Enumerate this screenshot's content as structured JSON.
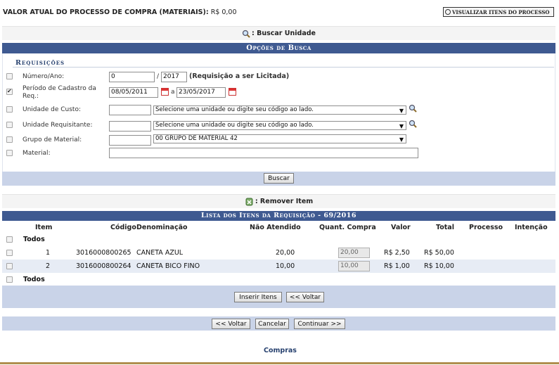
{
  "header": {
    "title_label": "VALOR ATUAL DO PROCESSO DE COMPRA (MATERIAIS):",
    "title_value": "R$ 0,00",
    "view_items_button": "VISUALIZAR ITENS DO PROCESSO"
  },
  "search_unit_link": ": Buscar Unidade",
  "search_options": {
    "header": "Opções de Busca",
    "caption": "Requisições",
    "number_year": {
      "label": "Número/Ano:",
      "number": "0",
      "year": "2017",
      "note": "(Requisição a ser Licitada)",
      "checked": false
    },
    "period": {
      "label": "Período de Cadastro da Req.:",
      "from": "08/05/2011",
      "sep": "a",
      "to": "23/05/2017",
      "checked": true
    },
    "cost_unit": {
      "label": "Unidade de Custo:",
      "code": "",
      "select": "Selecione uma unidade ou digite seu código ao lado.",
      "checked": false
    },
    "requesting_unit": {
      "label": "Unidade Requisitante:",
      "code": "",
      "select": "Selecione uma unidade ou digite seu código ao lado.",
      "checked": false
    },
    "material_group": {
      "label": "Grupo de Material:",
      "code": "",
      "select": "00 GRUPO DE MATERIAL 42",
      "checked": false
    },
    "material": {
      "label": "Material:",
      "value": "",
      "checked": false
    },
    "search_button": "Buscar"
  },
  "remove_item_link": ": Remover Item",
  "items_list": {
    "header": "Lista dos Itens da Requisição - 69/2016",
    "columns": [
      "Item",
      "Código",
      "Denominação",
      "Não Atendido",
      "Quant. Compra",
      "Valor",
      "Total",
      "Processo",
      "Intenção"
    ],
    "all_label": "Todos",
    "rows": [
      {
        "item": "1",
        "code": "3016000800265",
        "name": "CANETA AZUL",
        "not_served": "20,00",
        "qty": "20,00",
        "value": "R$ 2,50",
        "total": "R$ 50,00"
      },
      {
        "item": "2",
        "code": "3016000800264",
        "name": "CANETA BICO FINO",
        "not_served": "10,00",
        "qty": "10,00",
        "value": "R$ 1,00",
        "total": "R$ 10,00"
      }
    ],
    "insert_button": "Inserir Itens",
    "back_button": "<< Voltar"
  },
  "bottom_actions": {
    "back": "<< Voltar",
    "cancel": "Cancelar",
    "continue": "Continuar >>"
  },
  "footer_link": "Compras",
  "colors": {
    "header_blue": "#3f5a91",
    "bar_blue": "#c9d3e8",
    "row_alt": "#e7ecf5",
    "bottom_line": "#b08e4e"
  }
}
